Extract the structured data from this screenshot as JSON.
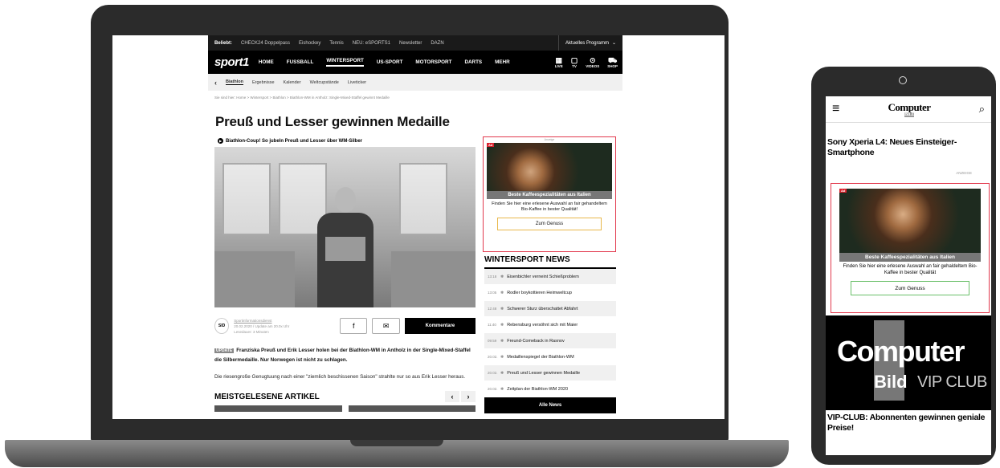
{
  "laptop": {
    "topbar": {
      "label": "Beliebt:",
      "links": [
        "CHECK24 Doppelpass",
        "Eishockey",
        "Tennis",
        "NEU: eSPORTS1",
        "Newsletter",
        "DAZN"
      ],
      "programm": "Aktuelles Programm",
      "programm_chevron": "⌄"
    },
    "nav": {
      "logo": "sport1",
      "items": [
        "HOME",
        "FUSSBALL",
        "WINTERSPORT",
        "US-SPORT",
        "MOTORSPORT",
        "DARTS",
        "MEHR"
      ],
      "icons": [
        {
          "icon": "calendar-icon",
          "glyph": "▦",
          "label": "LIVE"
        },
        {
          "icon": "tv-icon",
          "glyph": "▢",
          "label": "TV"
        },
        {
          "icon": "play-icon",
          "glyph": "⊙",
          "label": "VIDEOS"
        },
        {
          "icon": "cart-icon",
          "glyph": "⛟",
          "label": "SHOP"
        }
      ]
    },
    "subnav": {
      "back": "‹",
      "items": [
        "Biathlon",
        "Ergebnisse",
        "Kalender",
        "Weltcupstände",
        "Liveticker"
      ]
    },
    "breadcrumb": "Sie sind hier: Home > Wintersport > Biathlon > Biathlon-WM in Antholz: Single-Mixed-Staffel gewinnt Medaille",
    "headline": "Preuß und Lesser gewinnen Medaille",
    "video_title": "Biathlon-Coup! So jubeln Preuß und Lesser über WM-Silber",
    "meta": {
      "logo": "SID",
      "author": "Sportinformationsdienst",
      "date": "20.02.2020 / Update am 20.0x Uhr",
      "reading": "Lesedauer: 3 Minuten"
    },
    "share": {
      "facebook": "f",
      "mail": "✉",
      "comments": "Kommentare"
    },
    "lead_badge": "UPDATE",
    "lead": "Franziska Preuß und Erik Lesser holen bei der Biathlon-WM in Antholz in der Single-Mixed-Staffel die Silbermedaille. Nur Norwegen ist nicht zu schlagen.",
    "body": "Die riesengroße Genugtuung nach einer \"ziemlich beschissenen Saison\" strahlte nur so aus Erik Lesser heraus.",
    "most_read": {
      "title": "MEISTGELESENE ARTIKEL",
      "prev": "‹",
      "next": "›"
    },
    "ad": {
      "label": "Anzeige",
      "badge": "Ad",
      "title": "Beste Kaffeespezialitäten aus Italien",
      "text": "Finden Sie hier eine erlesene Auswahl an fair gehandeltem Bio-Kaffee in bester Qualität!",
      "button": "Zum Genuss"
    },
    "news": {
      "title": "WINTERSPORT NEWS",
      "items": [
        {
          "time": "13:18",
          "text": "Eisenbichler verneint Schießproblem"
        },
        {
          "time": "13:05",
          "text": "Rodler boykottieren Heimweltcup"
        },
        {
          "time": "12:48",
          "text": "Schwerer Sturz überschattet Abfahrt"
        },
        {
          "time": "11:40",
          "text": "Rebensburg versöhnt sich mit Maier"
        },
        {
          "time": "09:59",
          "text": "Freund-Comeback in Rasnov"
        },
        {
          "time": "20.02.",
          "text": "Medaillenspiegel der Biathlon-WM"
        },
        {
          "time": "20.02.",
          "text": "Preuß und Lesser gewinnen Medaille"
        },
        {
          "time": "20.02.",
          "text": "Zeitplan der Biathlon-WM 2020"
        }
      ],
      "all": "Alle News"
    }
  },
  "phone": {
    "menu_glyph": "≡",
    "logo": "Computer",
    "logo_sub": "BILD",
    "search_glyph": "⌕",
    "article_title": "Sony Xperia L4: Neues Einsteiger-Smartphone",
    "anzeige": "ANZEIGE",
    "ad": {
      "badge": "Ad",
      "title": "Beste Kaffeespezialitäten aus Italien",
      "text": "Finden Sie hier eine erlesene Auswahl an fair gehaldeltem Bio-Kaffee in bester Qualität",
      "button": "Zum Genuss"
    },
    "vip": {
      "top": "Computer",
      "bottom": "Bild",
      "club": "VIP CLUB"
    },
    "vip_title": "VIP-CLUB: Abonnenten gewinnen geniale Preise!"
  }
}
